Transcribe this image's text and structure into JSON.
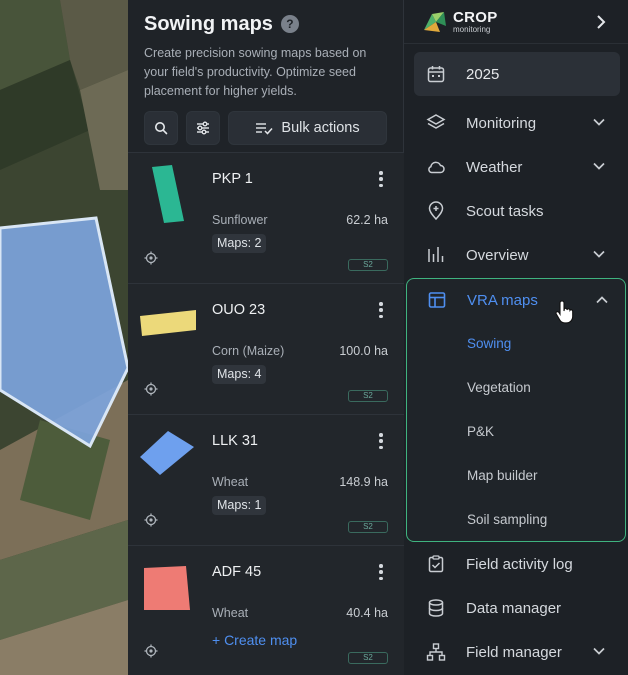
{
  "panel": {
    "title": "Sowing maps",
    "help_icon": "help-circle-icon",
    "help_glyph": "?",
    "description": "Create precision sowing maps based on your field's productivity. Optimize seed placement for higher yields.",
    "bulk_actions_label": "Bulk actions"
  },
  "fields": [
    {
      "name": "PKP 1",
      "crop": "Sunflower",
      "area": "62.2 ha",
      "maps": "Maps: 2",
      "source": "S2",
      "color": "#2bb793"
    },
    {
      "name": "OUO 23",
      "crop": "Corn (Maize)",
      "area": "100.0 ha",
      "maps": "Maps: 4",
      "source": "S2",
      "color": "#ecd97a"
    },
    {
      "name": "LLK 31",
      "crop": "Wheat",
      "area": "148.9 ha",
      "maps": "Maps: 1",
      "source": "S2",
      "color": "#6ea0ee"
    },
    {
      "name": "ADF 45",
      "crop": "Wheat",
      "area": "40.4 ha",
      "create_map": "+ Create map",
      "source": "S2",
      "color": "#ee7b74"
    }
  ],
  "nav": {
    "logo_main": "CROP",
    "logo_sub": "monitoring",
    "season": "2025",
    "items": [
      {
        "label": "Monitoring",
        "icon": "layers-icon",
        "has_chevron": true
      },
      {
        "label": "Weather",
        "icon": "cloud-icon",
        "has_chevron": true
      },
      {
        "label": "Scout tasks",
        "icon": "map-pin-plus-icon",
        "has_chevron": false
      },
      {
        "label": "Overview",
        "icon": "bar-chart-icon",
        "has_chevron": true
      }
    ],
    "vra": {
      "label": "VRA maps",
      "icon": "layout-icon",
      "sub_items": [
        "Sowing",
        "Vegetation",
        "P&K",
        "Map builder",
        "Soil sampling"
      ],
      "active_sub": "Sowing"
    },
    "bottom_items": [
      {
        "label": "Field activity log",
        "icon": "clipboard-check-icon",
        "has_chevron": false
      },
      {
        "label": "Data manager",
        "icon": "database-icon",
        "has_chevron": false
      },
      {
        "label": "Field manager",
        "icon": "hierarchy-icon",
        "has_chevron": true
      }
    ]
  },
  "colors": {
    "accent": "#4f8ff0",
    "highlight_border": "#3fb37f"
  }
}
